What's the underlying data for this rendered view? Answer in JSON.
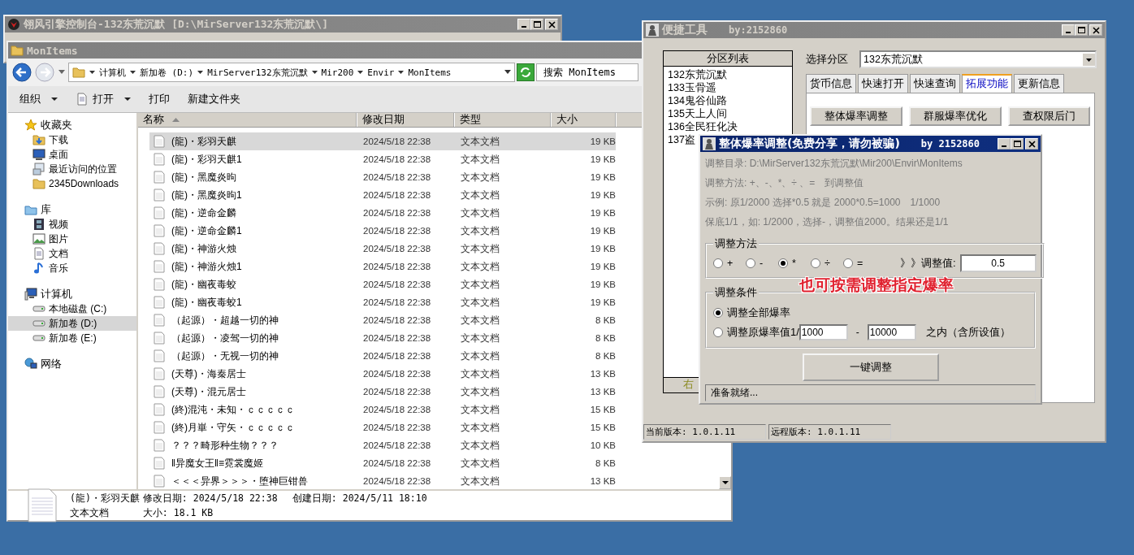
{
  "console_window": {
    "title": "翎风引擎控制台-132东荒沉默 [D:\\MirServer132东荒沉默\\]"
  },
  "explorer": {
    "title": "MonItems",
    "breadcrumb": [
      "计算机",
      "新加卷 (D:)",
      "MirServer132东荒沉默",
      "Mir200",
      "Envir",
      "MonItems"
    ],
    "search": {
      "placeholder": "搜索 MonItems"
    },
    "toolbar": [
      {
        "label": "组织",
        "kind": "plain",
        "dropdown": true
      },
      {
        "label": "打开",
        "kind": "doc",
        "dropdown": true
      },
      {
        "label": "打印",
        "kind": "plain",
        "dropdown": false
      },
      {
        "label": "新建文件夹",
        "kind": "plain",
        "dropdown": false
      }
    ],
    "nav": [
      {
        "label": "收藏夹",
        "kind": "star",
        "selected": false,
        "children": [
          {
            "label": "下载",
            "kind": "download",
            "selected": false
          },
          {
            "label": "桌面",
            "kind": "desktop",
            "selected": false
          },
          {
            "label": "最近访问的位置",
            "kind": "recent",
            "selected": false
          },
          {
            "label": "2345Downloads",
            "kind": "folder",
            "selected": false
          }
        ]
      },
      {
        "label": "库",
        "kind": "library",
        "selected": false,
        "children": [
          {
            "label": "视频",
            "kind": "video",
            "selected": false
          },
          {
            "label": "图片",
            "kind": "picture",
            "selected": false
          },
          {
            "label": "文档",
            "kind": "doc",
            "selected": false
          },
          {
            "label": "音乐",
            "kind": "music",
            "selected": false
          }
        ]
      },
      {
        "label": "计算机",
        "kind": "computer",
        "selected": false,
        "children": [
          {
            "label": "本地磁盘 (C:)",
            "kind": "drive",
            "selected": false
          },
          {
            "label": "新加卷 (D:)",
            "kind": "drive",
            "selected": true
          },
          {
            "label": "新加卷 (E:)",
            "kind": "drive",
            "selected": false
          }
        ]
      },
      {
        "label": "网络",
        "kind": "network",
        "selected": false
      }
    ],
    "columns": [
      {
        "label": "名称",
        "sorted": true
      },
      {
        "label": "修改日期",
        "sorted": false
      },
      {
        "label": "类型",
        "sorted": false
      },
      {
        "label": "大小",
        "sorted": false
      }
    ],
    "rows": [
      {
        "name": "(龍)・彩羽天麒",
        "date": "2024/5/18 22:38",
        "type": "文本文档",
        "size": "19 KB",
        "selected": true
      },
      {
        "name": "(龍)・彩羽天麒1",
        "date": "2024/5/18 22:38",
        "type": "文本文档",
        "size": "19 KB",
        "selected": false
      },
      {
        "name": "(龍)・黑魔炎昫",
        "date": "2024/5/18 22:38",
        "type": "文本文档",
        "size": "19 KB",
        "selected": false
      },
      {
        "name": "(龍)・黑魔炎昫1",
        "date": "2024/5/18 22:38",
        "type": "文本文档",
        "size": "19 KB",
        "selected": false
      },
      {
        "name": "(龍)・逆命金麟",
        "date": "2024/5/18 22:38",
        "type": "文本文档",
        "size": "19 KB",
        "selected": false
      },
      {
        "name": "(龍)・逆命金麟1",
        "date": "2024/5/18 22:38",
        "type": "文本文档",
        "size": "19 KB",
        "selected": false
      },
      {
        "name": "(龍)・神游火烛",
        "date": "2024/5/18 22:38",
        "type": "文本文档",
        "size": "19 KB",
        "selected": false
      },
      {
        "name": "(龍)・神游火烛1",
        "date": "2024/5/18 22:38",
        "type": "文本文档",
        "size": "19 KB",
        "selected": false
      },
      {
        "name": "(龍)・幽夜毒蛟",
        "date": "2024/5/18 22:38",
        "type": "文本文档",
        "size": "19 KB",
        "selected": false
      },
      {
        "name": "(龍)・幽夜毒蛟1",
        "date": "2024/5/18 22:38",
        "type": "文本文档",
        "size": "19 KB",
        "selected": false
      },
      {
        "name": "（起源）・超越一切的神",
        "date": "2024/5/18 22:38",
        "type": "文本文档",
        "size": "8 KB",
        "selected": false
      },
      {
        "name": "（起源）・凌驾一切的神",
        "date": "2024/5/18 22:38",
        "type": "文本文档",
        "size": "8 KB",
        "selected": false
      },
      {
        "name": "（起源）・无视一切的神",
        "date": "2024/5/18 22:38",
        "type": "文本文档",
        "size": "8 KB",
        "selected": false
      },
      {
        "name": "(天尊)・海秦居士",
        "date": "2024/5/18 22:38",
        "type": "文本文档",
        "size": "13 KB",
        "selected": false
      },
      {
        "name": "(天尊)・混元居士",
        "date": "2024/5/18 22:38",
        "type": "文本文档",
        "size": "13 KB",
        "selected": false
      },
      {
        "name": "(終)混沌・未知・ｃｃｃｃｃ",
        "date": "2024/5/18 22:38",
        "type": "文本文档",
        "size": "15 KB",
        "selected": false
      },
      {
        "name": "(終)月崋・守矢・ｃｃｃｃｃ",
        "date": "2024/5/18 22:38",
        "type": "文本文档",
        "size": "15 KB",
        "selected": false
      },
      {
        "name": "？？？畸形种生物？？？",
        "date": "2024/5/18 22:38",
        "type": "文本文档",
        "size": "10 KB",
        "selected": false
      },
      {
        "name": "‖异魔女王‖≡霓裳魔姬",
        "date": "2024/5/18 22:38",
        "type": "文本文档",
        "size": "8 KB",
        "selected": false
      },
      {
        "name": "＜＜＜异界＞＞＞・堕神巨钳兽",
        "date": "2024/5/18 22:38",
        "type": "文本文档",
        "size": "13 KB",
        "selected": false
      }
    ],
    "details": {
      "name": "(龍)・彩羽天麒",
      "modified": "修改日期: 2024/5/18 22:38",
      "created": "创建日期: 2024/5/11 18:10",
      "type": "文本文档",
      "size": "大小: 18.1 KB"
    }
  },
  "tool_window": {
    "title": "便捷工具",
    "author": "by:2152860",
    "list": {
      "header": "分区列表",
      "items": [
        "132东荒沉默",
        "133玉骨遥",
        "134鬼谷仙路",
        "135天上人间",
        "136全民狂化决",
        "137盗"
      ],
      "footer": "右"
    },
    "select": {
      "label": "选择分区",
      "value": "132东荒沉默"
    },
    "tabs": [
      {
        "label": "货币信息",
        "selected": false
      },
      {
        "label": "快速打开",
        "selected": false
      },
      {
        "label": "快速查询",
        "selected": false
      },
      {
        "label": "拓展功能",
        "selected": true
      },
      {
        "label": "更新信息",
        "selected": false
      }
    ],
    "buttons": [
      "整体爆率调整",
      "群服爆率优化",
      "查权限后门"
    ],
    "status": [
      "当前版本: 1.0.1.11",
      "远程版本: 1.0.1.11"
    ]
  },
  "dialog": {
    "title": "整体爆率调整(免费分享，请勿被骗)",
    "author": "by 2152860",
    "info": [
      "调整目录: D:\\MirServer132东荒沉默\\Mir200\\Envir\\MonItems",
      "调整方法: +、-、*、÷ 、=　到调整值",
      "示例: 原1/2000 选择*0.5 就是 2000*0.5=1000　1/1000",
      "保底1/1，如: 1/2000，选择-，调整值2000。结果还是1/1"
    ],
    "method": {
      "legend": "调整方法",
      "options": [
        {
          "label": "+",
          "selected": false
        },
        {
          "label": "-",
          "selected": false
        },
        {
          "label": "*",
          "selected": true
        },
        {
          "label": "÷",
          "selected": false
        },
        {
          "label": "=",
          "selected": false
        }
      ],
      "value_label": "》》调整值:",
      "value": "0.5"
    },
    "condition": {
      "legend": "调整条件",
      "options": [
        {
          "label": "调整全部爆率",
          "kind": "plain",
          "selected": true
        },
        {
          "label": "调整原爆率值1/",
          "kind": "range",
          "selected": false,
          "from": "1000",
          "separator": "-",
          "to": "10000",
          "suffix": "之内（含所设值）"
        }
      ]
    },
    "annotation": "也可按需调整指定爆率",
    "button": "一键调整",
    "status": "准备就绪..."
  }
}
